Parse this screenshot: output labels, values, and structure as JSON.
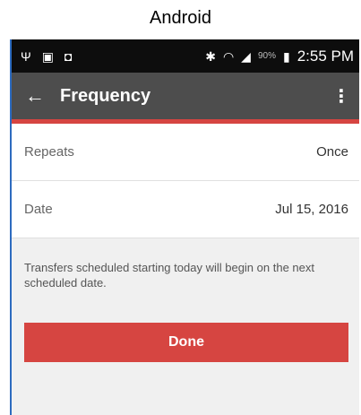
{
  "caption": "Android",
  "statusbar": {
    "left_icons": [
      "usb-icon",
      "screenshot-icon",
      "bag-icon"
    ],
    "right_icons": [
      "bluetooth-icon",
      "wifi-icon",
      "signal-icon"
    ],
    "battery_percent": "90%",
    "time": "2:55 PM"
  },
  "toolbar": {
    "title": "Frequency",
    "back_icon": "←",
    "overflow_icon": "⋮"
  },
  "rows": [
    {
      "label": "Repeats",
      "value": "Once"
    },
    {
      "label": "Date",
      "value": "Jul 15, 2016"
    }
  ],
  "note": "Transfers scheduled starting today will begin on the next scheduled date.",
  "done_label": "Done",
  "colors": {
    "accent": "#d64541",
    "toolbar": "#4d4d4d",
    "statusbar": "#0d0d0d"
  }
}
